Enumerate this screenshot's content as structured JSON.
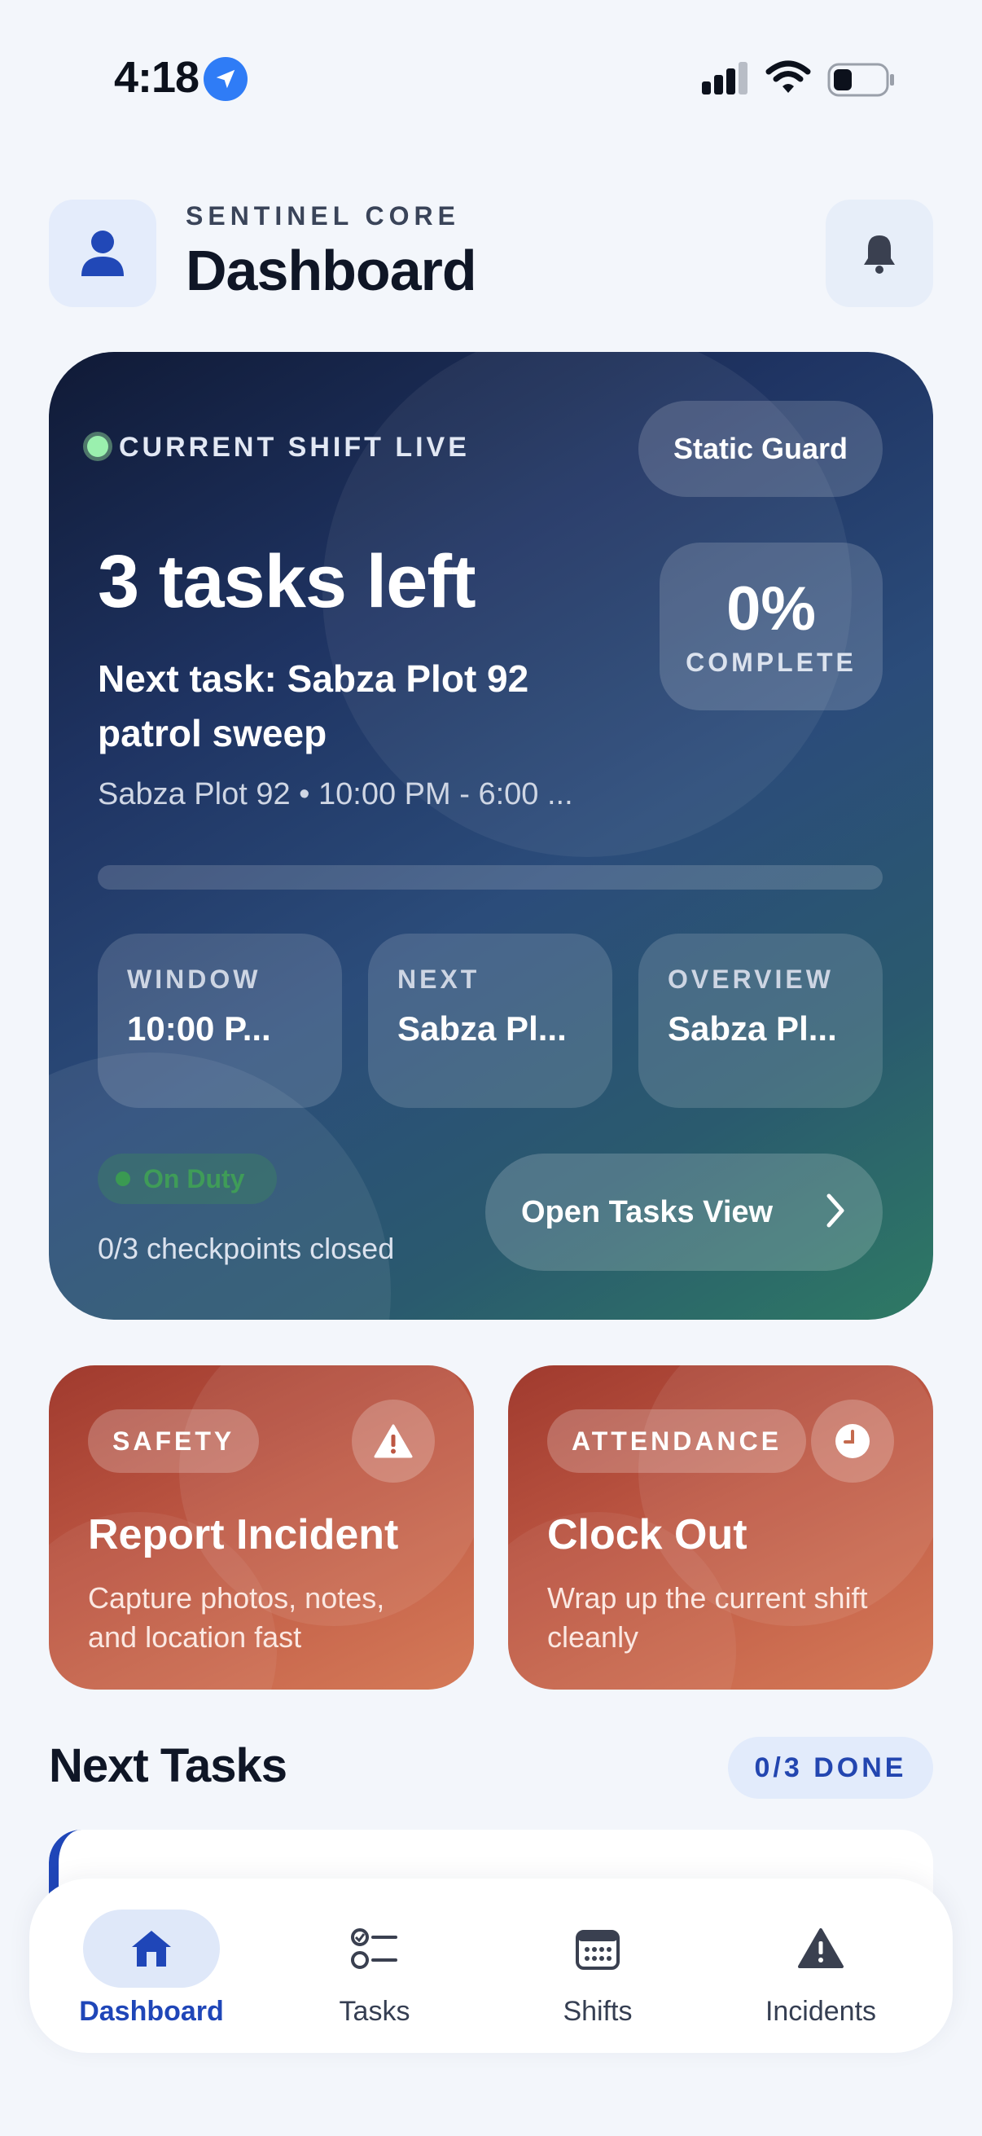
{
  "status_bar": {
    "time": "4:18"
  },
  "header": {
    "brand": "SENTINEL CORE",
    "title": "Dashboard"
  },
  "hero": {
    "live_label": "CURRENT SHIFT LIVE",
    "role": "Static Guard",
    "tasks_left": "3 tasks left",
    "next_task": "Next task: Sabza Plot 92 patrol sweep",
    "shift_meta": "Sabza Plot 92 • 10:00 PM - 6:00 ...",
    "progress_value": "0%",
    "progress_label": "COMPLETE",
    "progress_fraction": 0,
    "tiles": [
      {
        "label": "WINDOW",
        "value": "10:00 P..."
      },
      {
        "label": "NEXT",
        "value": "Sabza Pl..."
      },
      {
        "label": "OVERVIEW",
        "value": "Sabza Pl..."
      }
    ],
    "duty_status": "On Duty",
    "checkpoints": "0/3 checkpoints closed",
    "open_button": "Open Tasks View"
  },
  "actions": [
    {
      "tag": "SAFETY",
      "title": "Report Incident",
      "desc": "Capture photos, notes, and location fast",
      "icon": "warning-icon"
    },
    {
      "tag": "ATTENDANCE",
      "title": "Clock Out",
      "desc": "Wrap up the current shift cleanly",
      "icon": "clock-icon"
    }
  ],
  "next_tasks": {
    "title": "Next Tasks",
    "badge": "0/3 DONE"
  },
  "nav": {
    "items": [
      {
        "label": "Dashboard",
        "icon": "home-icon",
        "active": true
      },
      {
        "label": "Tasks",
        "icon": "checklist-icon",
        "active": false
      },
      {
        "label": "Shifts",
        "icon": "calendar-icon",
        "active": false
      },
      {
        "label": "Incidents",
        "icon": "warning-icon",
        "active": false
      }
    ]
  },
  "colors": {
    "accent": "#1f46b8",
    "live": "#9af0ae",
    "action": "#bd5743",
    "background": "#f3f6fb"
  }
}
